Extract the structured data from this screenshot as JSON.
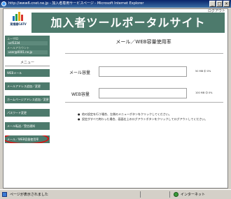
{
  "window": {
    "title": "http://www6.cnet.ne.jp - 加入者専用サービスページ - Microsoft Internet Explorer"
  },
  "header": {
    "brand": "東播磨CATV",
    "banner_title": "加入者ツールポータルサイト",
    "logout": "ログアウト"
  },
  "sidebar": {
    "info": [
      {
        "label": "ユーザID",
        "value": "ucf1234"
      },
      {
        "label": "メールアカウント",
        "value": "user@0001.ne.jp"
      }
    ],
    "menu_title": "メニュー",
    "items": [
      {
        "label": "WEBメール"
      },
      {
        "label": "メールアドレス追加／変更"
      },
      {
        "label": "ホームページアドレス追加／変更"
      },
      {
        "label": "パスワード変更"
      },
      {
        "label": "メール転送／受信通知"
      },
      {
        "label": "メール／WEB容量使用率"
      }
    ]
  },
  "main": {
    "title": "メール／WEB容量使用率",
    "rows": [
      {
        "label": "メール容量",
        "usage": "50 MB 中 0%",
        "percent": 0
      },
      {
        "label": "WEB容量",
        "usage": "100 MB 中 0%",
        "percent": 0
      }
    ],
    "notes": [
      "他の設定を行う場合、左側のメニューボタンをクリックしてください。",
      "設定がすべて終わった場合、画面右上のログアウトボタンをクリックしてログアウトしてください。"
    ]
  },
  "statusbar": {
    "text": "ページが表示されました",
    "zone": "インターネット"
  }
}
